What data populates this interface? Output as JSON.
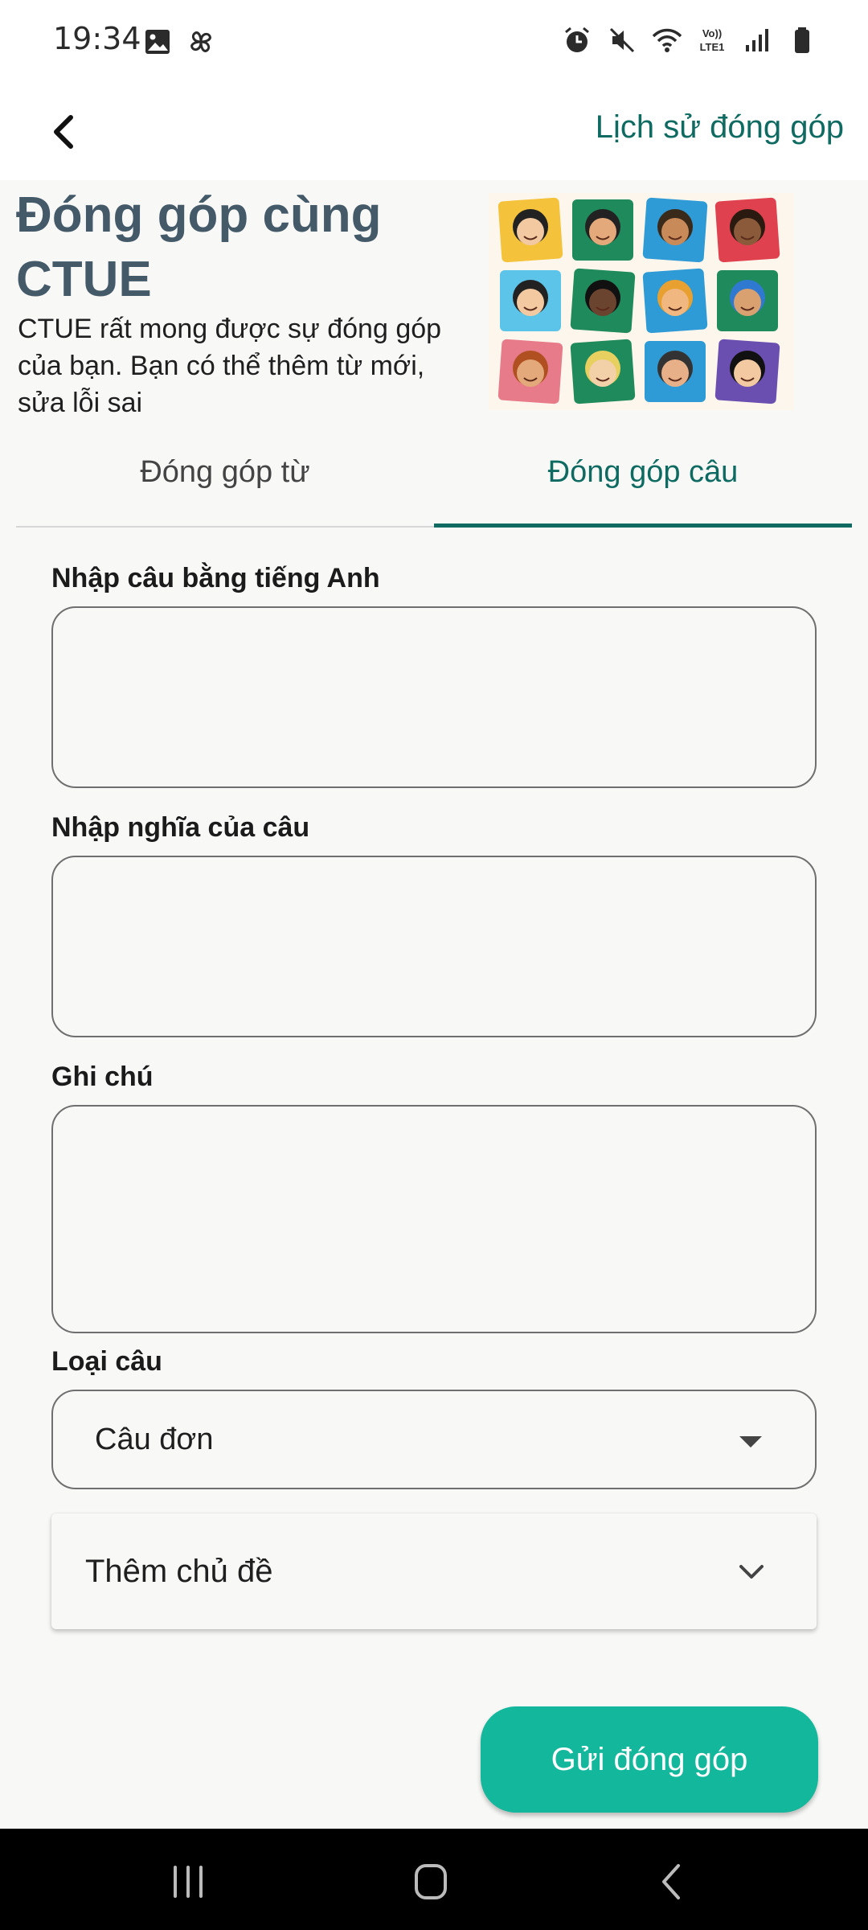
{
  "status_bar": {
    "time": "19:34",
    "left_icons": [
      "gallery-icon",
      "pinwheel-icon"
    ],
    "right_icons": [
      "alarm-icon",
      "mute-icon",
      "wifi-icon",
      "volte-icon",
      "signal-icon",
      "battery-icon"
    ],
    "volte_text_top": "Vo))",
    "volte_text_bottom": "LTE1"
  },
  "app_bar": {
    "back_icon": "chevron-left-icon",
    "history_link": "Lịch sử đóng góp"
  },
  "hero": {
    "title": "Đóng góp cùng CTUE",
    "description": "CTUE rất mong được sự đóng góp của bạn. Bạn có thể thêm từ mới, sửa lỗi sai",
    "image_icon": "puzzle-people-illustration"
  },
  "tabs": [
    {
      "label": "Đóng góp từ",
      "active": false
    },
    {
      "label": "Đóng góp câu",
      "active": true
    }
  ],
  "form": {
    "english_sentence_label": "Nhập câu bằng tiếng Anh",
    "english_sentence_value": "",
    "meaning_label": "Nhập nghĩa của câu",
    "meaning_value": "",
    "note_label": "Ghi chú",
    "note_value": "",
    "sentence_type_label": "Loại câu",
    "sentence_type_value": "Câu đơn",
    "add_topic_label": "Thêm chủ đề",
    "submit_label": "Gửi đóng góp"
  },
  "colors": {
    "accent": "#0f6b62",
    "title": "#455a69",
    "button": "#13b79c"
  },
  "nav_bar": {
    "icons": [
      "recent-apps-icon",
      "home-icon",
      "back-nav-icon"
    ]
  }
}
